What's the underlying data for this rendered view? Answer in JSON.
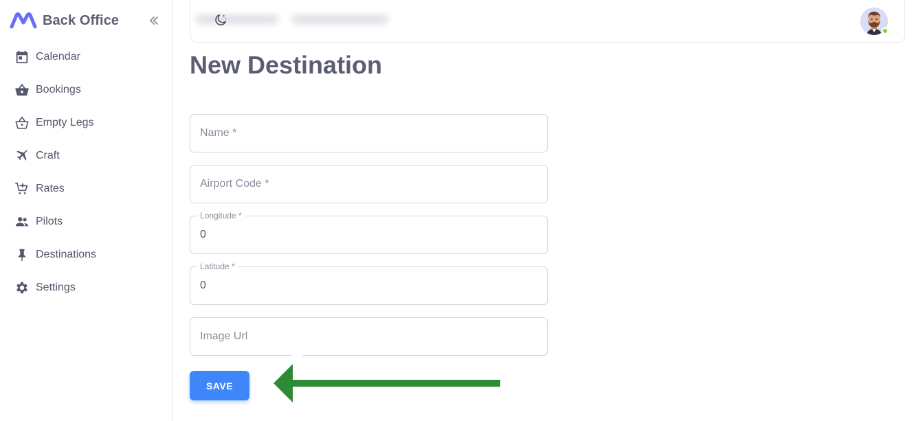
{
  "brand": {
    "title": "Back Office",
    "logo_color": "#6b6cf8"
  },
  "sidebar": {
    "collapse_icon": "double-chevron-left-icon",
    "items": [
      {
        "label": "Calendar",
        "icon": "calendar-icon"
      },
      {
        "label": "Bookings",
        "icon": "basket-icon"
      },
      {
        "label": "Empty Legs",
        "icon": "basket-outline-icon"
      },
      {
        "label": "Craft",
        "icon": "airplane-icon"
      },
      {
        "label": "Rates",
        "icon": "cart-plus-icon"
      },
      {
        "label": "Pilots",
        "icon": "users-icon"
      },
      {
        "label": "Destinations",
        "icon": "pin-icon"
      },
      {
        "label": "Settings",
        "icon": "gear-icon"
      }
    ]
  },
  "header": {
    "theme_icon": "moon-star-icon",
    "avatar_status_color": "#72e128"
  },
  "main": {
    "title": "New Destination",
    "fields": {
      "name": {
        "label": "Name *",
        "value": ""
      },
      "airport_code": {
        "label": "Airport Code *",
        "value": ""
      },
      "longitude": {
        "label": "Longitude *",
        "value": "0"
      },
      "latitude": {
        "label": "Latitude *",
        "value": "0"
      },
      "image_url": {
        "label": "Image Url",
        "value": ""
      }
    },
    "save_label": "SAVE"
  },
  "colors": {
    "primary": "#3f86fb",
    "arrow": "#2e8b35"
  }
}
